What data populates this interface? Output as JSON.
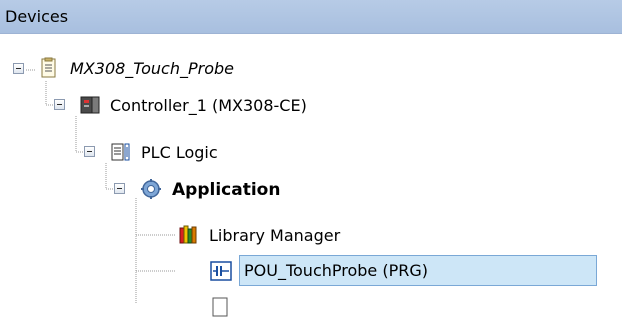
{
  "panel": {
    "title": "Devices"
  },
  "tree": {
    "project": "MX308_Touch_Probe",
    "controller": "Controller_1 (MX308-CE)",
    "plc_logic": "PLC Logic",
    "application": "Application",
    "library_manager": "Library Manager",
    "pou": "POU_TouchProbe (PRG)"
  }
}
